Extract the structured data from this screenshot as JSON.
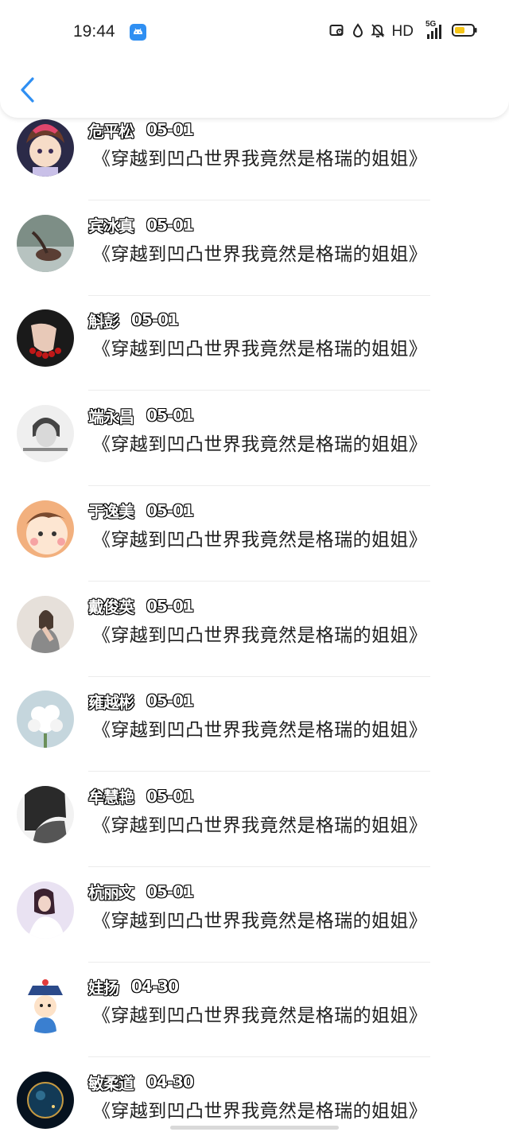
{
  "status_bar": {
    "time": "19:44",
    "network_label": "HD",
    "signal_label": "5G",
    "icons": [
      "android-app-icon",
      "nfc-icon",
      "water-drop-icon",
      "mute-bell-icon",
      "signal-icon",
      "battery-icon"
    ],
    "accent_color": "#2f8ff2",
    "battery_color": "#f5c518"
  },
  "header": {
    "back_icon": "chevron-left-icon"
  },
  "list": {
    "items": [
      {
        "name": "危平松",
        "date": "05-01",
        "title": "《穿越到凹凸世界我竟然是格瑞的姐姐》",
        "avatar": "anime-girl-avatar"
      },
      {
        "name": "宾冰真",
        "date": "05-01",
        "title": "《穿越到凹凸世界我竟然是格瑞的姐姐》",
        "avatar": "photo-avatar"
      },
      {
        "name": "斛彭",
        "date": "05-01",
        "title": "《穿越到凹凸世界我竟然是格瑞的姐姐》",
        "avatar": "hand-bracelet-avatar"
      },
      {
        "name": "端永昌",
        "date": "05-01",
        "title": "《穿越到凹凸世界我竟然是格瑞的姐姐》",
        "avatar": "bw-portrait-avatar"
      },
      {
        "name": "于逸美",
        "date": "05-01",
        "title": "《穿越到凹凸世界我竟然是格瑞的姐姐》",
        "avatar": "cartoon-face-avatar"
      },
      {
        "name": "戴俊英",
        "date": "05-01",
        "title": "《穿越到凹凸世界我竟然是格瑞的姐姐》",
        "avatar": "portrait-avatar"
      },
      {
        "name": "雍越彬",
        "date": "05-01",
        "title": "《穿越到凹凸世界我竟然是格瑞的姐姐》",
        "avatar": "white-flowers-avatar"
      },
      {
        "name": "牟慧艳",
        "date": "05-01",
        "title": "《穿越到凹凸世界我竟然是格瑞的姐姐》",
        "avatar": "silhouette-avatar"
      },
      {
        "name": "杭丽文",
        "date": "05-01",
        "title": "《穿越到凹凸世界我竟然是格瑞的姐姐》",
        "avatar": "woman-photo-avatar"
      },
      {
        "name": "娃扬",
        "date": "04-30",
        "title": "《穿越到凹凸世界我竟然是格瑞的姐姐》",
        "avatar": "cartoon-official-avatar"
      },
      {
        "name": "敏柔道",
        "date": "04-30",
        "title": "《穿越到凹凸世界我竟然是格瑞的姐姐》",
        "avatar": "planet-avatar"
      }
    ]
  }
}
